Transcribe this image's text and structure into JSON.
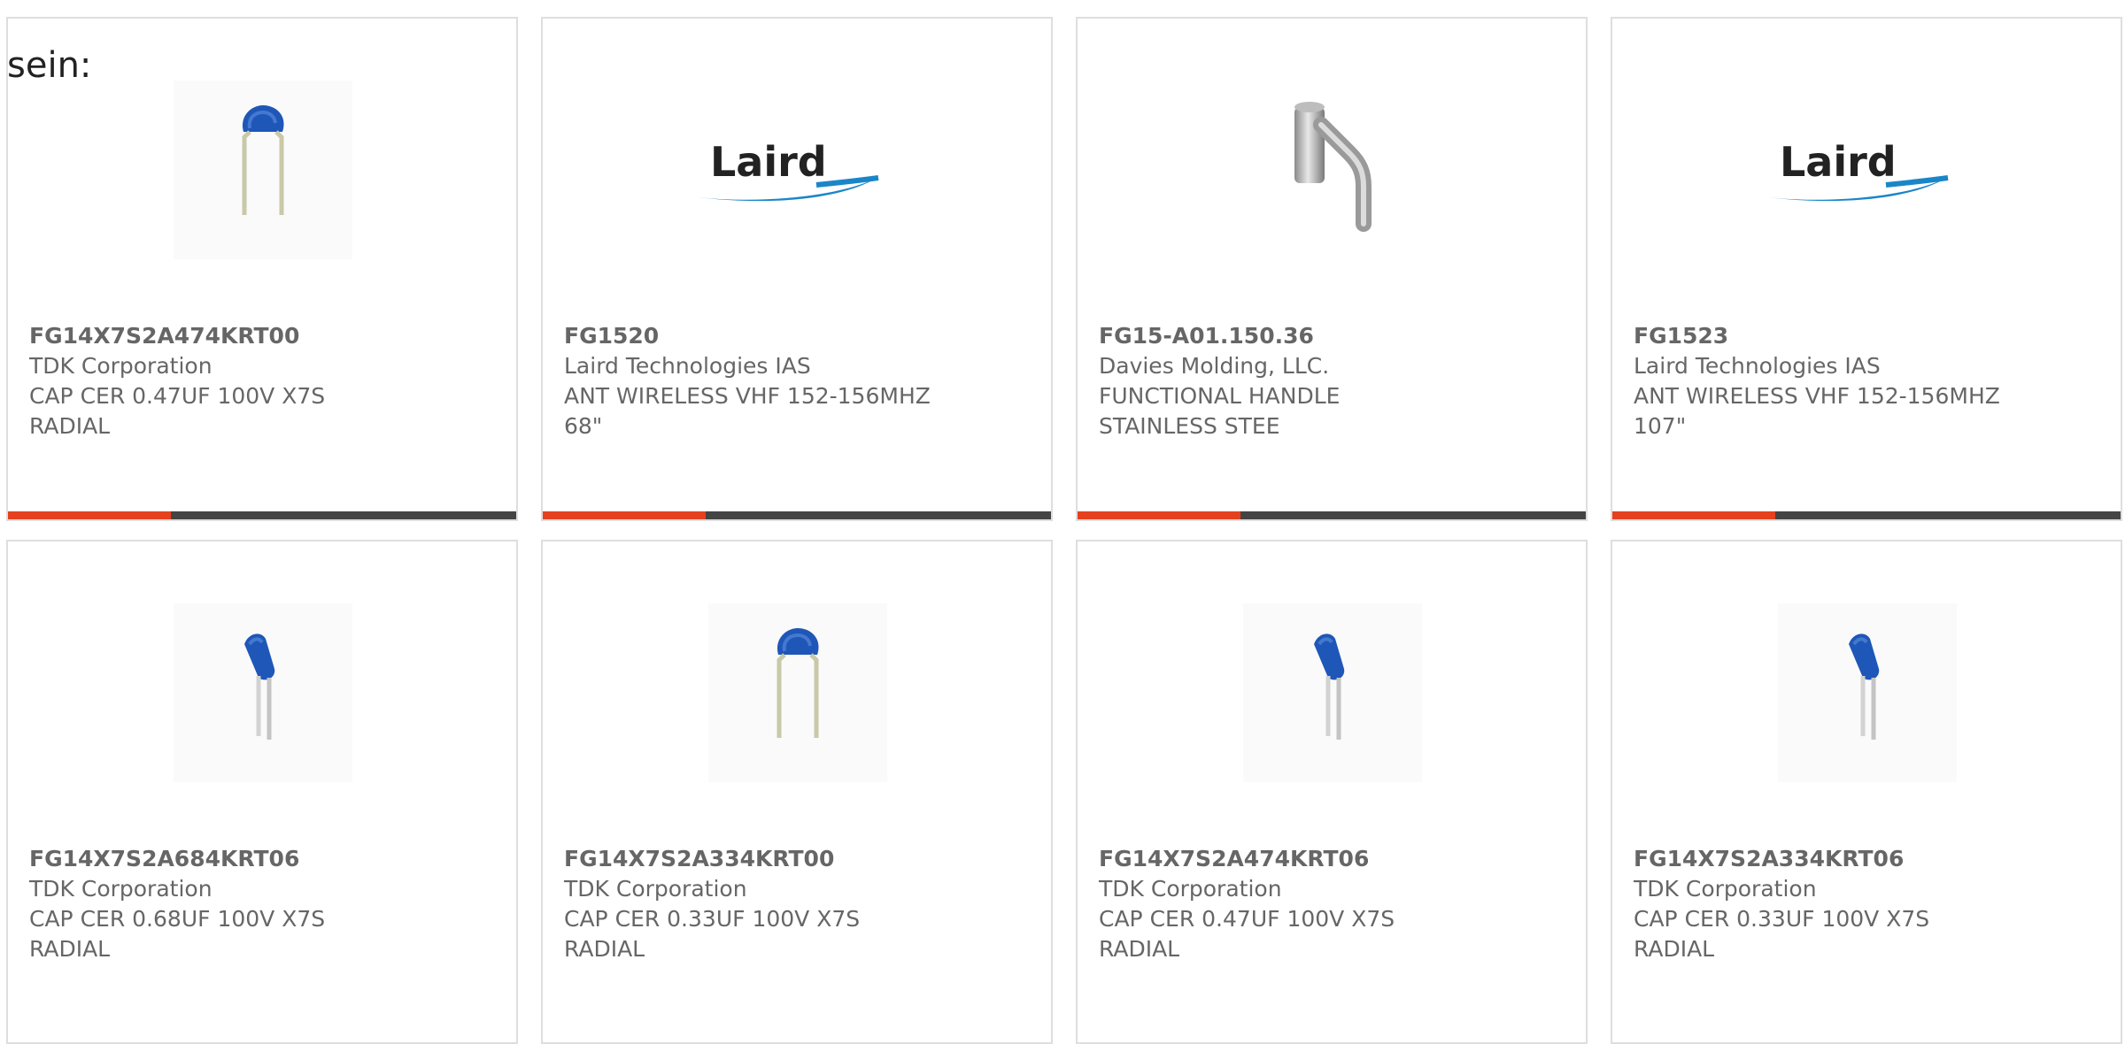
{
  "intro_text": "sein:",
  "colors": {
    "progress_fill": "#e5411f",
    "progress_track": "#444444",
    "capacitor_blue": "#1f57b8",
    "laird_blue": "#1a86c8"
  },
  "products": [
    {
      "part_number": "FG14X7S2A474KRT00",
      "manufacturer": "TDK Corporation",
      "description": "CAP CER 0.47UF 100V X7S RADIAL",
      "image": "capacitor-bent-leads-icon",
      "progress": 0.32
    },
    {
      "part_number": "FG1520",
      "manufacturer": "Laird Technologies IAS",
      "description": "ANT WIRELESS VHF 152-156MHZ 68\"",
      "image": "laird-logo",
      "logo_text": "Laird",
      "progress": 0.32
    },
    {
      "part_number": "FG15-A01.150.36",
      "manufacturer": "Davies Molding, LLC.",
      "description": "FUNCTIONAL HANDLE STAINLESS STEE",
      "image": "handle-icon",
      "progress": 0.32
    },
    {
      "part_number": "FG1523",
      "manufacturer": "Laird Technologies IAS",
      "description": "ANT WIRELESS VHF 152-156MHZ 107\"",
      "image": "laird-logo",
      "logo_text": "Laird",
      "progress": 0.32
    },
    {
      "part_number": "FG14X7S2A684KRT06",
      "manufacturer": "TDK Corporation",
      "description": "CAP CER 0.68UF 100V X7S RADIAL",
      "image": "capacitor-straight-leads-icon"
    },
    {
      "part_number": "FG14X7S2A334KRT00",
      "manufacturer": "TDK Corporation",
      "description": "CAP CER 0.33UF 100V X7S RADIAL",
      "image": "capacitor-bent-leads-icon"
    },
    {
      "part_number": "FG14X7S2A474KRT06",
      "manufacturer": "TDK Corporation",
      "description": "CAP CER 0.47UF 100V X7S RADIAL",
      "image": "capacitor-straight-leads-icon"
    },
    {
      "part_number": "FG14X7S2A334KRT06",
      "manufacturer": "TDK Corporation",
      "description": "CAP CER 0.33UF 100V X7S RADIAL",
      "image": "capacitor-straight-leads-icon"
    }
  ]
}
